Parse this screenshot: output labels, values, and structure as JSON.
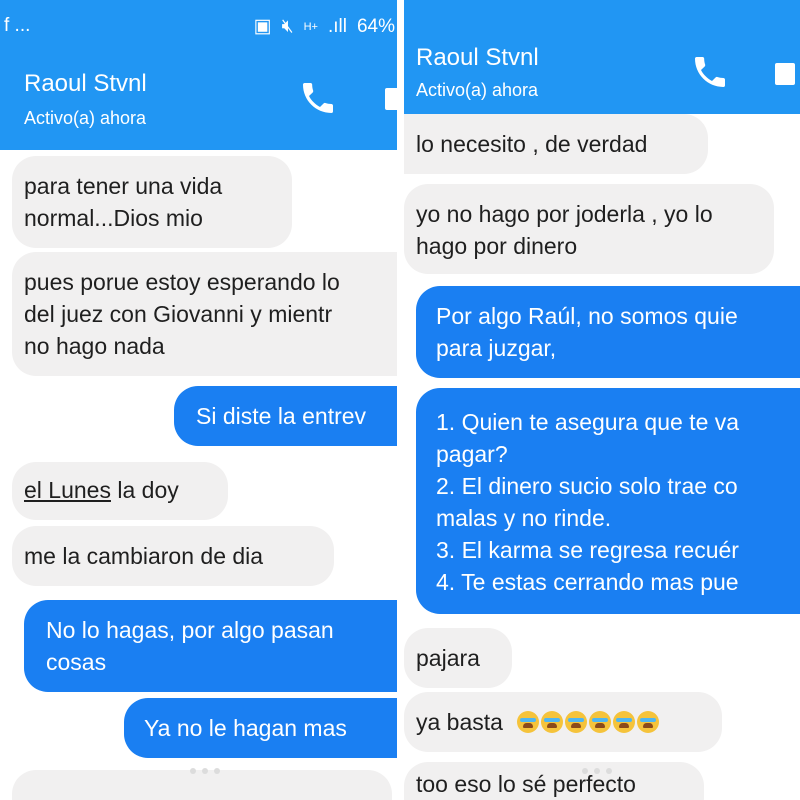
{
  "left": {
    "status": {
      "left_text": "f ...",
      "network": "H+",
      "signal": ".ıll",
      "battery": "64%"
    },
    "header": {
      "name": "Raoul Stvnl",
      "status": "Activo(a) ahora"
    },
    "messages": [
      {
        "lines": [
          "para tener una vida",
          "normal...Dios mio"
        ]
      },
      {
        "lines": [
          "pues porue estoy esperando lo",
          "del juez con Giovanni y mientr",
          "no hago nada"
        ]
      },
      {
        "lines": [
          "Si diste la entrev"
        ]
      },
      {
        "underline": "el Lunes",
        "rest": " la doy"
      },
      {
        "lines": [
          "me la cambiaron de dia"
        ]
      },
      {
        "lines": [
          "No lo hagas, por algo pasan",
          "cosas"
        ]
      },
      {
        "lines": [
          "Ya no le hagan mas"
        ]
      }
    ]
  },
  "right": {
    "header": {
      "name": "Raoul Stvnl",
      "status": "Activo(a) ahora"
    },
    "messages": [
      {
        "lines": [
          "lo necesito , de verdad"
        ]
      },
      {
        "lines": [
          "yo no hago por joderla , yo lo",
          "hago por dinero"
        ]
      },
      {
        "lines": [
          "Por algo Raúl, no somos quie",
          "para juzgar,"
        ]
      },
      {
        "lines": [
          "1. Quien te asegura que te va",
          "pagar?",
          "2. El dinero sucio solo trae co",
          "malas y no rinde.",
          "3. El karma se regresa recuér",
          "4. Te estas cerrando mas pue"
        ]
      },
      {
        "lines": [
          "pajara"
        ]
      },
      {
        "text": "ya basta",
        "emoji_count": 6,
        "emoji": "loudly-crying-face"
      },
      {
        "lines": [
          "too eso lo sé perfecto"
        ]
      }
    ]
  }
}
